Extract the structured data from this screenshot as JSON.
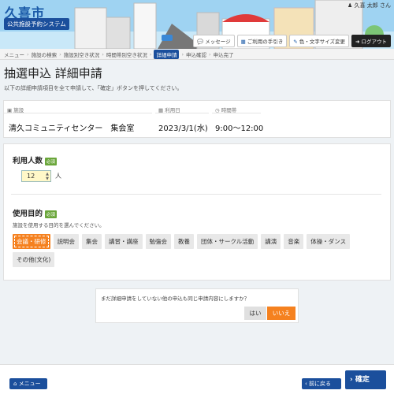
{
  "header": {
    "city_name": "久喜市",
    "system_name": "公共施設予約システム",
    "user_name": "久喜 太郎 さん",
    "buttons": [
      {
        "label": "メッセージ",
        "icon": "chat-icon"
      },
      {
        "label": "ご利用の手引き",
        "icon": "book-icon"
      },
      {
        "label": "色・文字サイズ変更",
        "icon": "brush-icon"
      },
      {
        "label": "ログアウト",
        "icon": "logout-icon"
      }
    ]
  },
  "breadcrumb": {
    "items": [
      "メニュー",
      "施設の検索",
      "施設別空き状況",
      "時間帯別空き状況",
      "詳細申請",
      "申込確認",
      "申込完了"
    ],
    "current_index": 4
  },
  "page": {
    "title": "抽選申込 詳細申請",
    "description": "以下の詳細申請項目を全て申請して、「確定」ボタンを押してください。"
  },
  "info": {
    "facility_label": "施設",
    "facility_value": "清久コミュニティセンター　集会室",
    "date_label": "利用日",
    "date_value": "2023/3/1(水)",
    "time_label": "時間帯",
    "time_value": "9:00～12:00"
  },
  "form": {
    "people_title": "利用人数",
    "required": "必須",
    "people_value": "12",
    "people_unit": "人",
    "purpose_title": "使用目的",
    "purpose_desc": "施設を使用する目的を選んでください。",
    "purposes": [
      "会議・研修",
      "説明会",
      "集会",
      "講習・講座",
      "勉強会",
      "教養",
      "団体・サークル活動",
      "講演",
      "音楽",
      "体操・ダンス",
      "その他(文化)"
    ],
    "selected_purpose": "会議・研修"
  },
  "dialog": {
    "question": "まだ詳細申請をしていない他の申込も同じ申請内容にしますか？",
    "yes": "はい",
    "no": "いいえ"
  },
  "footer": {
    "menu": "メニュー",
    "back": "前に戻る",
    "confirm": "確定"
  },
  "colors": {
    "primary": "#1b4f9c",
    "accent": "#f5811f",
    "required": "#6aa63a"
  }
}
